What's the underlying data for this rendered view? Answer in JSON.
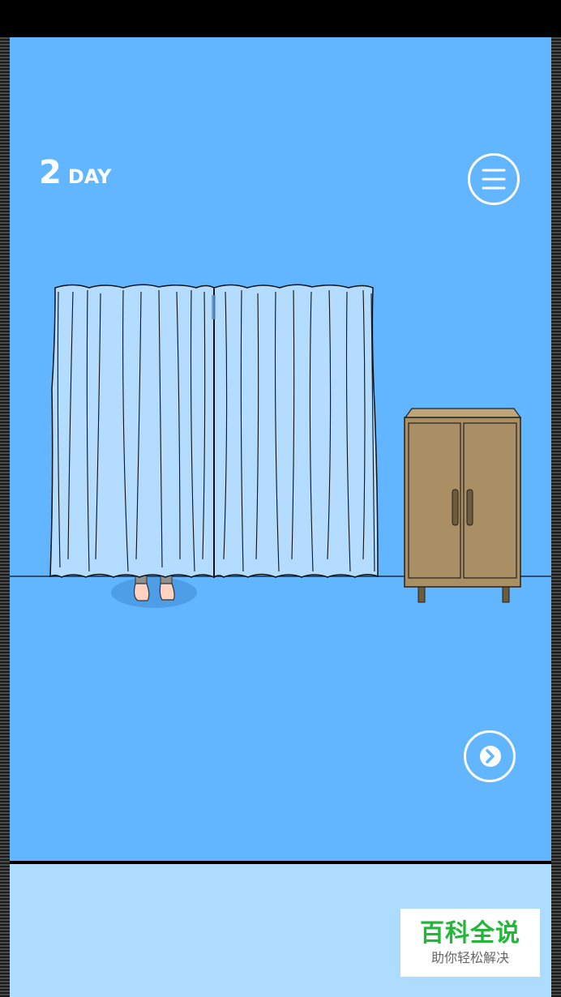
{
  "hud": {
    "day_number": "2",
    "day_label": "DAY"
  },
  "icons": {
    "menu": "hamburger-menu-icon",
    "next": "chevron-right-icon"
  },
  "scene": {
    "objects": [
      "curtain",
      "hidden-person-feet",
      "wooden-cabinet"
    ]
  },
  "watermark": {
    "title": "百科全说",
    "subtitle": "助你轻松解决"
  },
  "colors": {
    "sky": "#62b6ff",
    "panel": "#addcff",
    "curtain": "#b3dcff",
    "cabinet": "#a98f63",
    "watermark_green": "#21b838"
  }
}
